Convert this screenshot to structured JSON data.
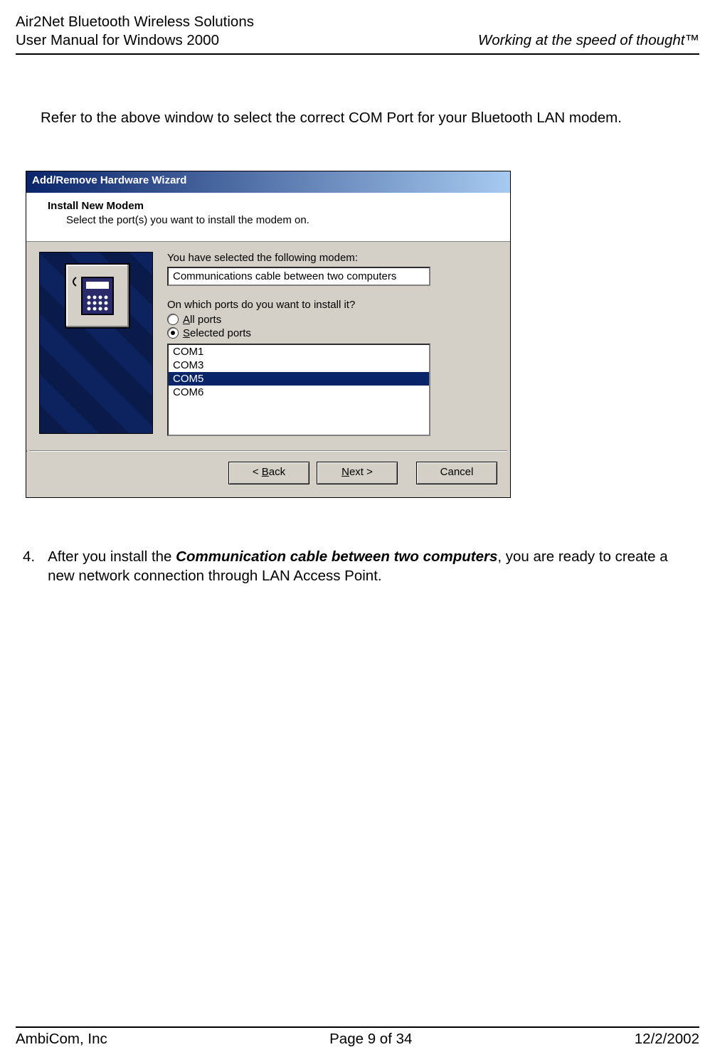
{
  "header": {
    "line1": "Air2Net Bluetooth Wireless Solutions",
    "line2": "User Manual for Windows 2000",
    "tagline": "Working at the speed of thought™"
  },
  "intro_text": "Refer to the above window to select the correct COM Port for your Bluetooth LAN modem.",
  "wizard": {
    "titlebar": "Add/Remove Hardware Wizard",
    "heading": "Install New Modem",
    "subheading": "Select the port(s) you want to install the modem on.",
    "selected_label": "You have selected the following modem:",
    "selected_value": "Communications cable between two computers",
    "ports_question": "On which ports do you want to install it?",
    "radio_all_prefix": "A",
    "radio_all_rest": "ll ports",
    "radio_sel_prefix": "S",
    "radio_sel_rest": "elected ports",
    "radio_all_selected": false,
    "radio_sel_selected": true,
    "ports": {
      "items": [
        "COM1",
        "COM3",
        "COM5",
        "COM6"
      ],
      "selected_index": 2
    },
    "buttons": {
      "back_lt": "< ",
      "back_u": "B",
      "back_rest": "ack",
      "next_u": "N",
      "next_rest": "ext >",
      "cancel": "Cancel"
    }
  },
  "step4": {
    "number": "4.",
    "pre": "After you install the ",
    "bold": "Communication cable between two computers",
    "post": ", you are ready to create a new network connection through LAN Access Point."
  },
  "footer": {
    "left": "AmbiCom, Inc",
    "center": "Page 9 of 34",
    "right": "12/2/2002"
  }
}
